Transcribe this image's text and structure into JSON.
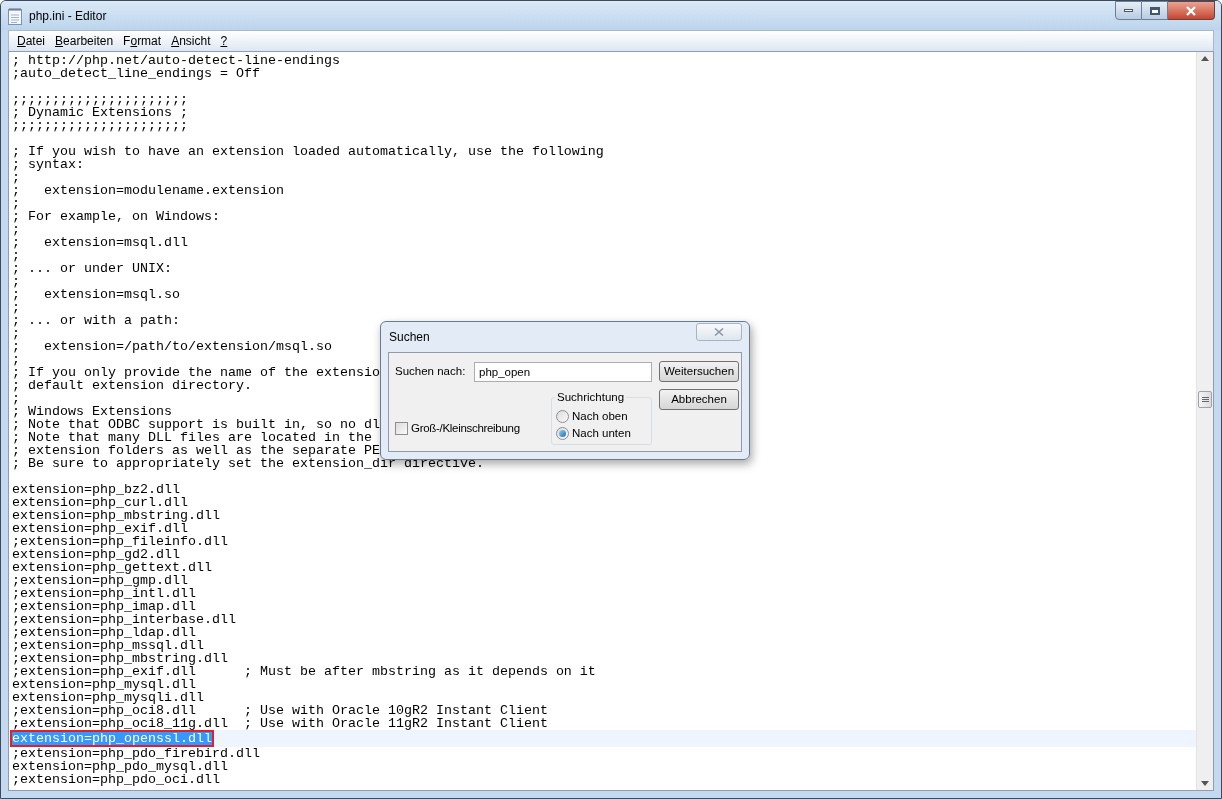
{
  "window": {
    "title": "php.ini - Editor"
  },
  "menu": [
    {
      "key": "D",
      "after": "atei"
    },
    {
      "key": "B",
      "after": "earbeiten"
    },
    {
      "before": "F",
      "key": "o",
      "after": "rmat"
    },
    {
      "key": "A",
      "after": "nsicht"
    },
    {
      "key": "?"
    }
  ],
  "editor_lines": [
    {
      "text": "; http://php.net/auto-detect-line-endings",
      "selected": false
    },
    {
      "text": ";auto_detect_line_endings = Off",
      "selected": false
    },
    {
      "selected": false
    },
    {
      "text": ";;;;;;;;;;;;;;;;;;;;;;",
      "selected": false
    },
    {
      "text": "; Dynamic Extensions ;",
      "selected": false
    },
    {
      "text": ";;;;;;;;;;;;;;;;;;;;;;",
      "selected": false
    },
    {
      "selected": false
    },
    {
      "text": "; If you wish to have an extension loaded automatically, use the following",
      "selected": false
    },
    {
      "text": "; syntax:",
      "selected": false
    },
    {
      "text": ";",
      "selected": false
    },
    {
      "text": ";   extension=modulename.extension",
      "selected": false
    },
    {
      "text": ";",
      "selected": false
    },
    {
      "text": "; For example, on Windows:",
      "selected": false
    },
    {
      "text": ";",
      "selected": false
    },
    {
      "text": ";   extension=msql.dll",
      "selected": false
    },
    {
      "text": ";",
      "selected": false
    },
    {
      "text": "; ... or under UNIX:",
      "selected": false
    },
    {
      "text": ";",
      "selected": false
    },
    {
      "text": ";   extension=msql.so",
      "selected": false
    },
    {
      "text": ";",
      "selected": false
    },
    {
      "text": "; ... or with a path:",
      "selected": false
    },
    {
      "text": ";",
      "selected": false
    },
    {
      "text": ";   extension=/path/to/extension/msql.so",
      "selected": false
    },
    {
      "text": ";",
      "selected": false
    },
    {
      "text": "; If you only provide the name of the extensio",
      "selected": false
    },
    {
      "text": "; default extension directory.",
      "selected": false
    },
    {
      "text": ";",
      "selected": false
    },
    {
      "text": "; Windows Extensions",
      "selected": false
    },
    {
      "text": "; Note that ODBC support is built in, so no dl",
      "selected": false
    },
    {
      "text": "; Note that many DLL files are located in the",
      "selected": false
    },
    {
      "text": "; extension folders as well as the separate PE",
      "selected": false
    },
    {
      "text": "; Be sure to appropriately set the extension_dir directive.",
      "selected": false
    },
    {
      "selected": false
    },
    {
      "text": "extension=php_bz2.dll",
      "selected": false
    },
    {
      "text": "extension=php_curl.dll",
      "selected": false
    },
    {
      "text": "extension=php_mbstring.dll",
      "selected": false
    },
    {
      "text": "extension=php_exif.dll",
      "selected": false
    },
    {
      "text": ";extension=php_fileinfo.dll",
      "selected": false
    },
    {
      "text": "extension=php_gd2.dll",
      "selected": false
    },
    {
      "text": "extension=php_gettext.dll",
      "selected": false
    },
    {
      "text": ";extension=php_gmp.dll",
      "selected": false
    },
    {
      "text": ";extension=php_intl.dll",
      "selected": false
    },
    {
      "text": ";extension=php_imap.dll",
      "selected": false
    },
    {
      "text": ";extension=php_interbase.dll",
      "selected": false
    },
    {
      "text": ";extension=php_ldap.dll",
      "selected": false
    },
    {
      "text": ";extension=php_mssql.dll",
      "selected": false
    },
    {
      "text": ";extension=php_mbstring.dll",
      "selected": false
    },
    {
      "text": ";extension=php_exif.dll      ; Must be after mbstring as it depends on it",
      "selected": false
    },
    {
      "text": "extension=php_mysql.dll",
      "selected": false
    },
    {
      "text": "extension=php_mysqli.dll",
      "selected": false
    },
    {
      "text": ";extension=php_oci8.dll      ; Use with Oracle 10gR2 Instant Client",
      "selected": false
    },
    {
      "text": ";extension=php_oci8_11g.dll  ; Use with Oracle 11gR2 Instant Client",
      "selected": false
    },
    {
      "text": "extension=php_openssl.dll",
      "selected": true
    },
    {
      "text": ";extension=php_pdo_firebird.dll",
      "selected": false
    },
    {
      "text": "extension=php_pdo_mysql.dll",
      "selected": false
    },
    {
      "text": ";extension=php_pdo_oci.dll",
      "selected": false
    }
  ],
  "find_dialog": {
    "title": "Suchen",
    "search_label": "Suchen nach:",
    "search_value": "php_open",
    "find_next_button": "Weitersuchen",
    "cancel_button": "Abbrechen",
    "direction": {
      "title": "Suchrichtung",
      "options": [
        {
          "label": "Nach oben",
          "selected": false
        },
        {
          "label": "Nach unten",
          "selected": true
        }
      ]
    },
    "match_case": {
      "label": "Groß-/Kleinschreibung",
      "checked": false
    }
  }
}
